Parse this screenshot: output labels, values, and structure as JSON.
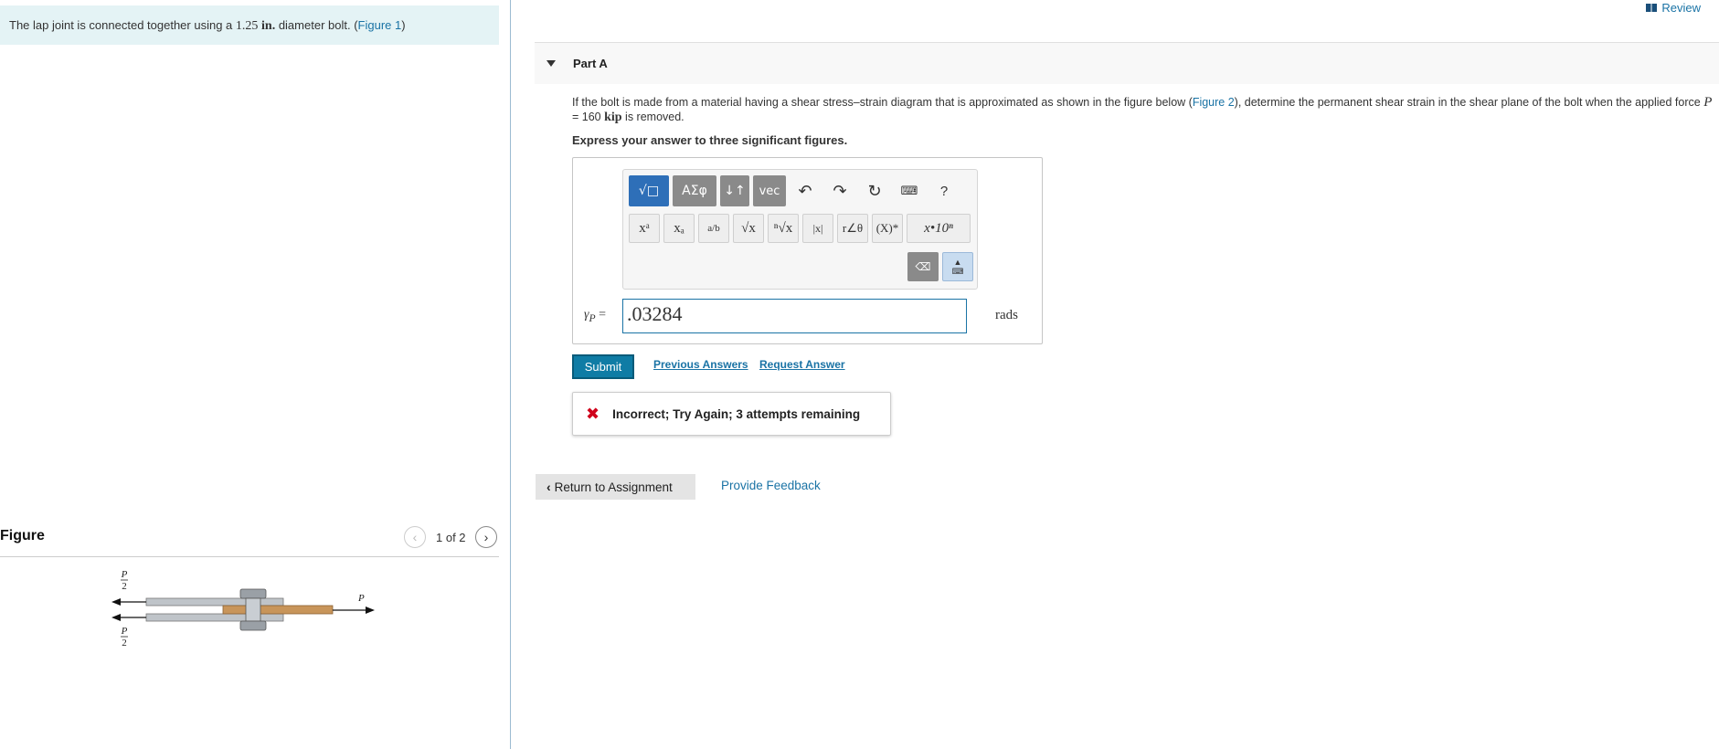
{
  "problem": {
    "text_before": "The lap joint is connected together using a ",
    "value": "1.25",
    "unit": "in.",
    "text_after": " diameter bolt. (",
    "figure_link": "Figure 1",
    "text_close": ")"
  },
  "figure": {
    "title": "Figure",
    "counter": "1 of 2",
    "prev_icon": "chevron-left-icon",
    "next_icon": "chevron-right-icon",
    "labels": {
      "p_half": "P",
      "p_half_den": "2",
      "p": "P"
    }
  },
  "header": {
    "review_label": "Review",
    "review_icon": "book-icon"
  },
  "part": {
    "title": "Part A",
    "question_1": "If the bolt is made from a material having a shear stress–strain diagram that is approximated as shown in the figure below (",
    "figure_link": "Figure 2",
    "question_2": "), determine the permanent shear strain in the shear plane of the bolt when the applied force ",
    "force_var": "P",
    "force_eq": " = 160 ",
    "force_unit": "kip",
    "question_3": " is removed.",
    "instruction": "Express your answer to three significant figures."
  },
  "toolbar": {
    "templates": "√□",
    "greek": "ΑΣφ",
    "arrows": "↓↑",
    "vec": "vec",
    "undo_icon": "undo-icon",
    "redo_icon": "redo-icon",
    "reset_icon": "reset-icon",
    "keyboard_icon": "keyboard-icon",
    "help": "?",
    "row2": [
      "xᵃ",
      "xₐ",
      "a/b",
      "√x",
      "ⁿ√x",
      "|x|",
      "r∠θ",
      "(X)*",
      "x•10ⁿ"
    ]
  },
  "answer": {
    "label_var": "γ",
    "label_sub": "P",
    "label_eq": " =",
    "value": ".03284",
    "unit": "rads"
  },
  "actions": {
    "submit": "Submit",
    "previous_answers": "Previous Answers",
    "request_answer": "Request Answer"
  },
  "feedback": {
    "text": "Incorrect; Try Again; 3 attempts remaining",
    "icon": "x-icon",
    "color": "#d0021b"
  },
  "footer": {
    "return": "Return to Assignment",
    "provide_feedback": "Provide Feedback"
  }
}
